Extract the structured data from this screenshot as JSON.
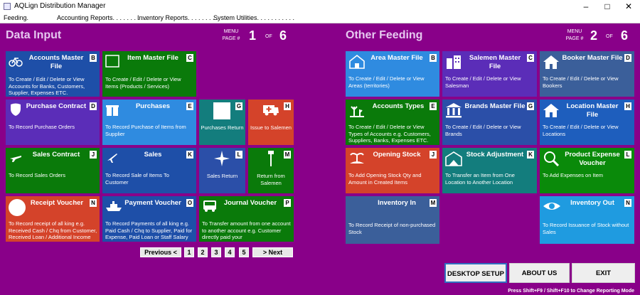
{
  "window": {
    "title": "AQLign Distribution Manager"
  },
  "menu": [
    "Feeding.",
    "Accounting Reports. . . . . . . . . .",
    "Inventory Reports. . . . . . . . .",
    "System Utilities. . . . . . . . . . ."
  ],
  "left": {
    "title": "Data Input",
    "menu_label": "MENU",
    "page_label": "PAGE #",
    "page": "1",
    "of": "OF",
    "total": "6",
    "tiles": [
      {
        "title": "Accounts Master File",
        "key": "B",
        "desc": "To Create / Edit / Delete or View Accounts for Banks, Customers, Supplier, Expenses ETC."
      },
      {
        "title": "Item Master File",
        "key": "C",
        "desc": "To Create / Edit / Delete or View Items (Products / Services)"
      },
      {
        "title": "Purchase Contract",
        "key": "D",
        "desc": "To Record Purchase Orders"
      },
      {
        "title": "Purchases",
        "key": "E",
        "desc": "To Record Purchase of Items from Supplier"
      },
      {
        "title": "",
        "key": "G",
        "desc": "Purchases Return"
      },
      {
        "title": "",
        "key": "H",
        "desc": "Issue to Salemen"
      },
      {
        "title": "Sales Contract",
        "key": "J",
        "desc": "To Record Sales Orders"
      },
      {
        "title": "Sales",
        "key": "K",
        "desc": "To Record Sale of Items To Customer"
      },
      {
        "title": "",
        "key": "L",
        "desc": "Sales Return"
      },
      {
        "title": "",
        "key": "M",
        "desc": "Return from Salemen"
      },
      {
        "title": "Receipt Voucher",
        "key": "N",
        "desc": "To Record receipt of all king e.g. Received Cash / Chq from Customer, Received Loan / Additional Income"
      },
      {
        "title": "Payment Voucher",
        "key": "O",
        "desc": "To Record Payments of all king e.g. Paid Cash / Chq to Supplier, Paid for Expense, Paid Loan or Staff Salary"
      },
      {
        "title": "Journal Voucher",
        "key": "P",
        "desc": "To Transfer amount from one account to another account e.g. Customer directly paid your"
      }
    ],
    "nav": {
      "prev": "Previous <",
      "pages": [
        "1",
        "2",
        "3",
        "4",
        "5"
      ],
      "next": "> Next"
    }
  },
  "right": {
    "title": "Other Feeding",
    "menu_label": "MENU",
    "page_label": "PAGE #",
    "page": "2",
    "of": "OF",
    "total": "6",
    "tiles": [
      {
        "title": "Area Master File",
        "key": "B",
        "desc": "To Create / Edit / Delete or View Areas (territories)"
      },
      {
        "title": "Salemen Master File",
        "key": "C",
        "desc": "To Create / Edit / Delete or View Salesman"
      },
      {
        "title": "Booker Master File",
        "key": "D",
        "desc": "To Create / Edit / Delete or View Bookers"
      },
      {
        "title": "Accounts Types",
        "key": "E",
        "desc": "To Create / Edit / Delete or View Types of Accounts e.g. Customers, Suppliers, Banks, Expenses ETC."
      },
      {
        "title": "Brands Master File",
        "key": "G",
        "desc": "To Create / Edit / Delete or View Brands"
      },
      {
        "title": "Location Master File",
        "key": "H",
        "desc": "To Create / Edit / Delete or View Locations"
      },
      {
        "title": "Opening Stock",
        "key": "J",
        "desc": "To Add Opening Stock Qty and Amount in Created Items"
      },
      {
        "title": "Stock Adjustment",
        "key": "K",
        "desc": "To Transfer an Item from One Location to Another Location"
      },
      {
        "title": "Product Expense Voucher",
        "key": "L",
        "desc": "To Add Expenses on Item"
      },
      {
        "title": "Inventory In",
        "key": "M",
        "desc": "To Record Receipt of non-purchased Stock"
      },
      {
        "title": "Inventory Out",
        "key": "N",
        "desc": "To Record Issuance of Stock without Sales"
      }
    ]
  },
  "buttons": {
    "desktop": "DESKTOP SETUP",
    "about": "ABOUT US",
    "exit": "EXIT"
  },
  "footer": "Press Shift+F9 / Shift+F10 to Change Reporting Mode",
  "colors": {
    "background": "#890089",
    "blue": "#1e5ebd",
    "green": "#0a7a0a",
    "purple": "#5b2db8",
    "lightblue": "#2f8be0",
    "teal": "#137d7d",
    "red": "#d4432a",
    "navy": "#2b4fa8",
    "steel": "#3b5f9a",
    "cyan": "#1f9be0"
  }
}
